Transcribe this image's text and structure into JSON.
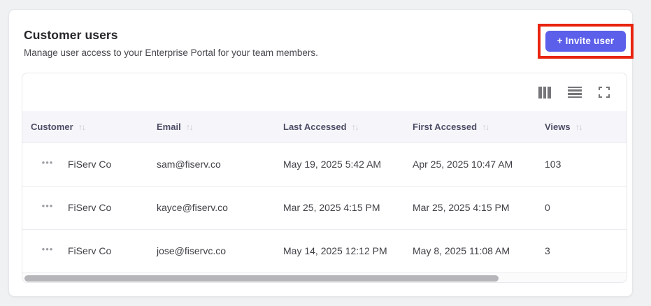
{
  "page": {
    "title": "Customer users",
    "subtitle": "Manage user access to your Enterprise Portal for your team members.",
    "invite_button_label": "+ Invite user"
  },
  "icons": {
    "sort": "↑↓",
    "row_menu": "•••"
  },
  "table": {
    "columns": [
      "Customer",
      "Email",
      "Last Accessed",
      "First Accessed",
      "Views"
    ],
    "rows": [
      {
        "customer": "FiServ Co",
        "email": "sam@fiserv.co",
        "last_accessed": "May 19, 2025 5:42 AM",
        "first_accessed": "Apr 25, 2025 10:47 AM",
        "views": "103"
      },
      {
        "customer": "FiServ Co",
        "email": "kayce@fiserv.co",
        "last_accessed": "Mar 25, 2025 4:15 PM",
        "first_accessed": "Mar 25, 2025 4:15 PM",
        "views": "0"
      },
      {
        "customer": "FiServ Co",
        "email": "jose@fiservc.co",
        "last_accessed": "May 14, 2025 12:12 PM",
        "first_accessed": "May 8, 2025 11:08 AM",
        "views": "3"
      }
    ]
  },
  "colors": {
    "accent_button": "#5b5fe9",
    "annotation_highlight": "#e8240f",
    "header_row_bg": "#f6f6fa",
    "page_bg": "#eff1f3"
  }
}
